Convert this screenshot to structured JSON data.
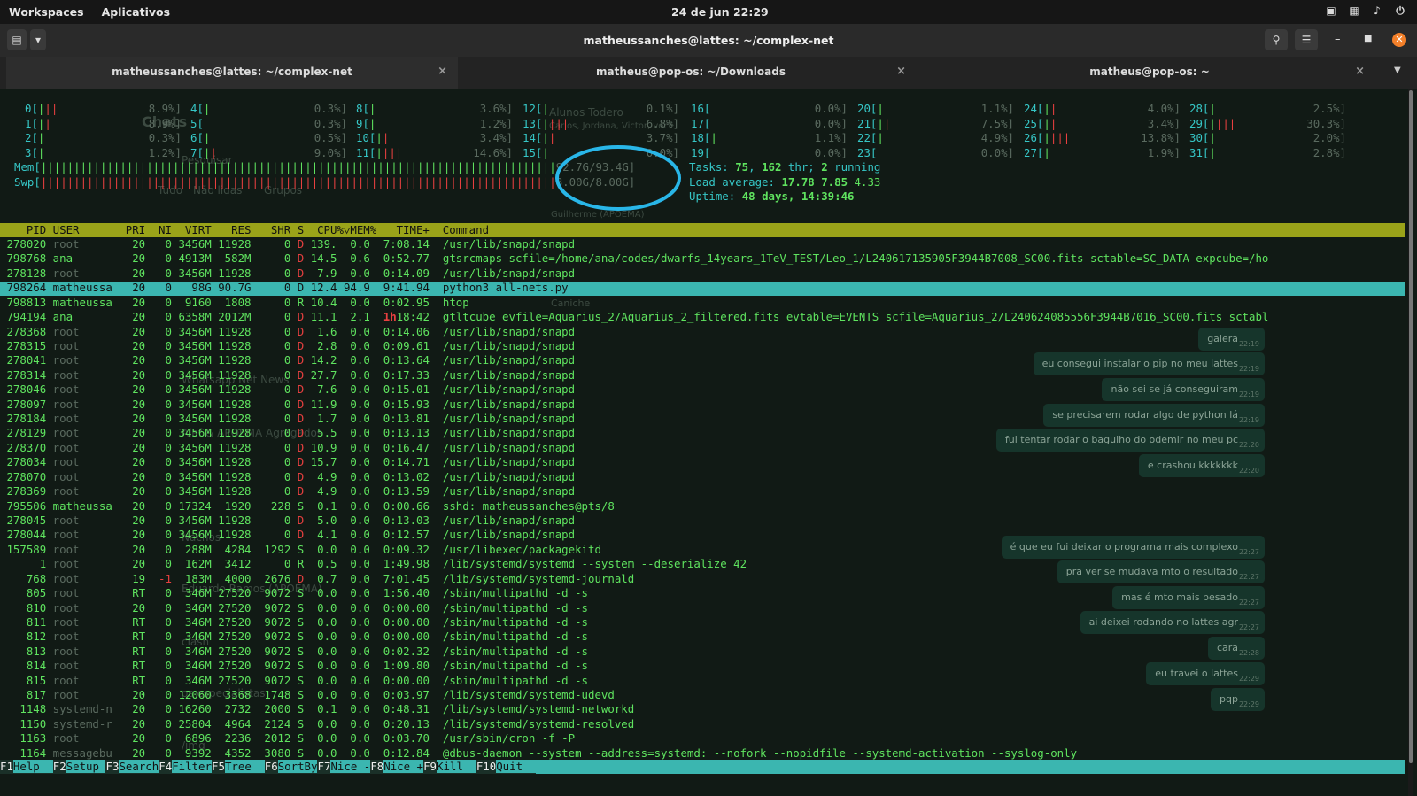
{
  "topbar": {
    "workspaces": "Workspaces",
    "apps": "Aplicativos",
    "clock": "24 de jun  22:29"
  },
  "window": {
    "title": "matheussanches@lattes: ~/complex-net"
  },
  "tabs": [
    {
      "label": "matheussanches@lattes: ~/complex-net",
      "active": true
    },
    {
      "label": "matheus@pop-os: ~/Downloads",
      "active": false
    },
    {
      "label": "matheus@pop-os: ~",
      "active": false
    }
  ],
  "htop": {
    "cpus": [
      [
        "0[|||",
        "8.9%]",
        "4[|",
        "0.3%]",
        "8[|",
        "3.6%]",
        "12[|",
        "0.1%]",
        "16[",
        "0.0%]",
        "20[|",
        "1.1%]",
        "24[||",
        "4.0%]",
        "28[|",
        "2.5%]"
      ],
      [
        "1[||",
        "8.9%]",
        "5[",
        "0.3%]",
        "9[|",
        "1.2%]",
        "13[||||",
        "6.8%]",
        "17[",
        "0.0%]",
        "21[||",
        "7.5%]",
        "25[||",
        "3.4%]",
        "29[||||",
        "30.3%]"
      ],
      [
        "2[|",
        "0.3%]",
        "6[|",
        "0.5%]",
        "10[||",
        "3.4%]",
        "14[||",
        "3.7%]",
        "18[|",
        "1.1%]",
        "22[|",
        "4.9%]",
        "26[||||",
        "13.8%]",
        "30[|",
        "2.0%]"
      ],
      [
        "3[|",
        "1.2%]",
        "7[||",
        "9.0%]",
        "11[||||",
        "14.6%]",
        "15[|",
        "0.0%]",
        "19[",
        "0.0%]",
        "23[",
        "0.0%]",
        "27[|",
        "1.9%]",
        "31[|",
        "2.8%]"
      ]
    ],
    "mem_label": "Mem[",
    "mem_value": "92.7G/93.4G]",
    "swp_label": "Swp[",
    "swp_value": "8.00G/8.00G]",
    "tasks_text": "Tasks: ",
    "tasks": "75",
    "thr": "162",
    "thr_label": " thr; ",
    "running": "2",
    "running_label": " running",
    "load_label": "Load average: ",
    "load1": "17.78",
    "load5": "7.85",
    "load15": "4.33",
    "uptime_label": "Uptime: ",
    "uptime": "48 days, 14:39:46",
    "header": "    PID USER       PRI  NI  VIRT   RES   SHR S  CPU%▽MEM%   TIME+  Command",
    "rows": [
      {
        "pid": "278020",
        "user": "root",
        "pri": "20",
        "ni": "0",
        "virt": "3456M",
        "res": "11928",
        "shr": "0",
        "s": "D",
        "cpu": "139.",
        "mem": "0.0",
        "time": "7:08.14",
        "cmd": "/usr/lib/snapd/snapd"
      },
      {
        "pid": "798768",
        "user": "ana",
        "pri": "20",
        "ni": "0",
        "virt": "4913M",
        "res": "582M",
        "shr": "0",
        "s": "D",
        "cpu": "14.5",
        "mem": "0.6",
        "time": "0:52.77",
        "cmd": "gtsrcmaps scfile=/home/ana/codes/dwarfs_14years_1TeV_TEST/Leo_1/L240617135905F3944B7008_SC00.fits sctable=SC_DATA expcube=/ho"
      },
      {
        "pid": "278128",
        "user": "root",
        "pri": "20",
        "ni": "0",
        "virt": "3456M",
        "res": "11928",
        "shr": "0",
        "s": "D",
        "cpu": "7.9",
        "mem": "0.0",
        "time": "0:14.09",
        "cmd": "/usr/lib/snapd/snapd"
      },
      {
        "pid": "798264",
        "user": "matheussa",
        "pri": "20",
        "ni": "0",
        "virt": "98G",
        "res": "90.7G",
        "shr": "0",
        "s": "D",
        "cpu": "12.4",
        "mem": "94.9",
        "time": "9:41.94",
        "cmd": "python3 all-nets.py",
        "selected": true
      },
      {
        "pid": "798813",
        "user": "matheussa",
        "pri": "20",
        "ni": "0",
        "virt": "9160",
        "res": "1808",
        "shr": "0",
        "s": "R",
        "cpu": "10.4",
        "mem": "0.0",
        "time": "0:02.95",
        "cmd": "htop"
      },
      {
        "pid": "794194",
        "user": "ana",
        "pri": "20",
        "ni": "0",
        "virt": "6358M",
        "res": "2012M",
        "shr": "0",
        "s": "D",
        "cpu": "11.1",
        "mem": "2.1",
        "time": "1h18:42",
        "cmd": "gtltcube evfile=Aquarius_2/Aquarius_2_filtered.fits evtable=EVENTS scfile=Aquarius_2/L240624085556F3944B7016_SC00.fits sctabl"
      },
      {
        "pid": "278368",
        "user": "root",
        "pri": "20",
        "ni": "0",
        "virt": "3456M",
        "res": "11928",
        "shr": "0",
        "s": "D",
        "cpu": "1.6",
        "mem": "0.0",
        "time": "0:14.06",
        "cmd": "/usr/lib/snapd/snapd"
      },
      {
        "pid": "278315",
        "user": "root",
        "pri": "20",
        "ni": "0",
        "virt": "3456M",
        "res": "11928",
        "shr": "0",
        "s": "D",
        "cpu": "2.8",
        "mem": "0.0",
        "time": "0:09.61",
        "cmd": "/usr/lib/snapd/snapd"
      },
      {
        "pid": "278041",
        "user": "root",
        "pri": "20",
        "ni": "0",
        "virt": "3456M",
        "res": "11928",
        "shr": "0",
        "s": "D",
        "cpu": "14.2",
        "mem": "0.0",
        "time": "0:13.64",
        "cmd": "/usr/lib/snapd/snapd"
      },
      {
        "pid": "278314",
        "user": "root",
        "pri": "20",
        "ni": "0",
        "virt": "3456M",
        "res": "11928",
        "shr": "0",
        "s": "D",
        "cpu": "27.7",
        "mem": "0.0",
        "time": "0:17.33",
        "cmd": "/usr/lib/snapd/snapd"
      },
      {
        "pid": "278046",
        "user": "root",
        "pri": "20",
        "ni": "0",
        "virt": "3456M",
        "res": "11928",
        "shr": "0",
        "s": "D",
        "cpu": "7.6",
        "mem": "0.0",
        "time": "0:15.01",
        "cmd": "/usr/lib/snapd/snapd"
      },
      {
        "pid": "278097",
        "user": "root",
        "pri": "20",
        "ni": "0",
        "virt": "3456M",
        "res": "11928",
        "shr": "0",
        "s": "D",
        "cpu": "11.9",
        "mem": "0.0",
        "time": "0:15.93",
        "cmd": "/usr/lib/snapd/snapd"
      },
      {
        "pid": "278184",
        "user": "root",
        "pri": "20",
        "ni": "0",
        "virt": "3456M",
        "res": "11928",
        "shr": "0",
        "s": "D",
        "cpu": "1.7",
        "mem": "0.0",
        "time": "0:13.81",
        "cmd": "/usr/lib/snapd/snapd"
      },
      {
        "pid": "278129",
        "user": "root",
        "pri": "20",
        "ni": "0",
        "virt": "3456M",
        "res": "11928",
        "shr": "0",
        "s": "D",
        "cpu": "5.5",
        "mem": "0.0",
        "time": "0:13.13",
        "cmd": "/usr/lib/snapd/snapd"
      },
      {
        "pid": "278370",
        "user": "root",
        "pri": "20",
        "ni": "0",
        "virt": "3456M",
        "res": "11928",
        "shr": "0",
        "s": "D",
        "cpu": "10.9",
        "mem": "0.0",
        "time": "0:16.47",
        "cmd": "/usr/lib/snapd/snapd"
      },
      {
        "pid": "278034",
        "user": "root",
        "pri": "20",
        "ni": "0",
        "virt": "3456M",
        "res": "11928",
        "shr": "0",
        "s": "D",
        "cpu": "15.7",
        "mem": "0.0",
        "time": "0:14.71",
        "cmd": "/usr/lib/snapd/snapd"
      },
      {
        "pid": "278070",
        "user": "root",
        "pri": "20",
        "ni": "0",
        "virt": "3456M",
        "res": "11928",
        "shr": "0",
        "s": "D",
        "cpu": "4.9",
        "mem": "0.0",
        "time": "0:13.02",
        "cmd": "/usr/lib/snapd/snapd"
      },
      {
        "pid": "278369",
        "user": "root",
        "pri": "20",
        "ni": "0",
        "virt": "3456M",
        "res": "11928",
        "shr": "0",
        "s": "D",
        "cpu": "4.9",
        "mem": "0.0",
        "time": "0:13.59",
        "cmd": "/usr/lib/snapd/snapd"
      },
      {
        "pid": "795506",
        "user": "matheussa",
        "pri": "20",
        "ni": "0",
        "virt": "17324",
        "res": "1920",
        "shr": "228",
        "s": "S",
        "cpu": "0.1",
        "mem": "0.0",
        "time": "0:00.66",
        "cmd": "sshd: matheussanches@pts/8"
      },
      {
        "pid": "278045",
        "user": "root",
        "pri": "20",
        "ni": "0",
        "virt": "3456M",
        "res": "11928",
        "shr": "0",
        "s": "D",
        "cpu": "5.0",
        "mem": "0.0",
        "time": "0:13.03",
        "cmd": "/usr/lib/snapd/snapd"
      },
      {
        "pid": "278044",
        "user": "root",
        "pri": "20",
        "ni": "0",
        "virt": "3456M",
        "res": "11928",
        "shr": "0",
        "s": "D",
        "cpu": "4.1",
        "mem": "0.0",
        "time": "0:12.57",
        "cmd": "/usr/lib/snapd/snapd"
      },
      {
        "pid": "157589",
        "user": "root",
        "pri": "20",
        "ni": "0",
        "virt": "288M",
        "res": "4284",
        "shr": "1292",
        "s": "S",
        "cpu": "0.0",
        "mem": "0.0",
        "time": "0:09.32",
        "cmd": "/usr/libexec/packagekitd"
      },
      {
        "pid": "1",
        "user": "root",
        "pri": "20",
        "ni": "0",
        "virt": "162M",
        "res": "3412",
        "shr": "0",
        "s": "R",
        "cpu": "0.5",
        "mem": "0.0",
        "time": "1:49.98",
        "cmd": "/lib/systemd/systemd --system --deserialize 42"
      },
      {
        "pid": "768",
        "user": "root",
        "pri": "19",
        "ni": "-1",
        "virt": "183M",
        "res": "4000",
        "shr": "2676",
        "s": "D",
        "cpu": "0.7",
        "mem": "0.0",
        "time": "7:01.45",
        "cmd": "/lib/systemd/systemd-journald"
      },
      {
        "pid": "805",
        "user": "root",
        "pri": "RT",
        "ni": "0",
        "virt": "346M",
        "res": "27520",
        "shr": "9072",
        "s": "S",
        "cpu": "0.0",
        "mem": "0.0",
        "time": "1:56.40",
        "cmd": "/sbin/multipathd -d -s"
      },
      {
        "pid": "810",
        "user": "root",
        "pri": "20",
        "ni": "0",
        "virt": "346M",
        "res": "27520",
        "shr": "9072",
        "s": "S",
        "cpu": "0.0",
        "mem": "0.0",
        "time": "0:00.00",
        "cmd": "/sbin/multipathd -d -s"
      },
      {
        "pid": "811",
        "user": "root",
        "pri": "RT",
        "ni": "0",
        "virt": "346M",
        "res": "27520",
        "shr": "9072",
        "s": "S",
        "cpu": "0.0",
        "mem": "0.0",
        "time": "0:00.00",
        "cmd": "/sbin/multipathd -d -s"
      },
      {
        "pid": "812",
        "user": "root",
        "pri": "RT",
        "ni": "0",
        "virt": "346M",
        "res": "27520",
        "shr": "9072",
        "s": "S",
        "cpu": "0.0",
        "mem": "0.0",
        "time": "0:00.00",
        "cmd": "/sbin/multipathd -d -s"
      },
      {
        "pid": "813",
        "user": "root",
        "pri": "RT",
        "ni": "0",
        "virt": "346M",
        "res": "27520",
        "shr": "9072",
        "s": "S",
        "cpu": "0.0",
        "mem": "0.0",
        "time": "0:02.32",
        "cmd": "/sbin/multipathd -d -s"
      },
      {
        "pid": "814",
        "user": "root",
        "pri": "RT",
        "ni": "0",
        "virt": "346M",
        "res": "27520",
        "shr": "9072",
        "s": "S",
        "cpu": "0.0",
        "mem": "0.0",
        "time": "1:09.80",
        "cmd": "/sbin/multipathd -d -s"
      },
      {
        "pid": "815",
        "user": "root",
        "pri": "RT",
        "ni": "0",
        "virt": "346M",
        "res": "27520",
        "shr": "9072",
        "s": "S",
        "cpu": "0.0",
        "mem": "0.0",
        "time": "0:00.00",
        "cmd": "/sbin/multipathd -d -s"
      },
      {
        "pid": "817",
        "user": "root",
        "pri": "20",
        "ni": "0",
        "virt": "12060",
        "res": "3368",
        "shr": "1748",
        "s": "S",
        "cpu": "0.0",
        "mem": "0.0",
        "time": "0:03.97",
        "cmd": "/lib/systemd/systemd-udevd"
      },
      {
        "pid": "1148",
        "user": "systemd-n",
        "pri": "20",
        "ni": "0",
        "virt": "16260",
        "res": "2732",
        "shr": "2000",
        "s": "S",
        "cpu": "0.1",
        "mem": "0.0",
        "time": "0:48.31",
        "cmd": "/lib/systemd/systemd-networkd"
      },
      {
        "pid": "1150",
        "user": "systemd-r",
        "pri": "20",
        "ni": "0",
        "virt": "25804",
        "res": "4964",
        "shr": "2124",
        "s": "S",
        "cpu": "0.0",
        "mem": "0.0",
        "time": "0:20.13",
        "cmd": "/lib/systemd/systemd-resolved"
      },
      {
        "pid": "1163",
        "user": "root",
        "pri": "20",
        "ni": "0",
        "virt": "6896",
        "res": "2236",
        "shr": "2012",
        "s": "S",
        "cpu": "0.0",
        "mem": "0.0",
        "time": "0:03.70",
        "cmd": "/usr/sbin/cron -f -P"
      },
      {
        "pid": "1164",
        "user": "messagebu",
        "pri": "20",
        "ni": "0",
        "virt": "9392",
        "res": "4352",
        "shr": "3080",
        "s": "S",
        "cpu": "0.0",
        "mem": "0.0",
        "time": "0:12.84",
        "cmd": "@dbus-daemon --system --address=systemd: --nofork --nopidfile --systemd-activation --syslog-only"
      }
    ],
    "fkeys": [
      {
        "k": "F1",
        "l": "Help  "
      },
      {
        "k": "F2",
        "l": "Setup "
      },
      {
        "k": "F3",
        "l": "Search"
      },
      {
        "k": "F4",
        "l": "Filter"
      },
      {
        "k": "F5",
        "l": "Tree  "
      },
      {
        "k": "F6",
        "l": "SortBy"
      },
      {
        "k": "F7",
        "l": "Nice -"
      },
      {
        "k": "F8",
        "l": "Nice +"
      },
      {
        "k": "F9",
        "l": "Kill  "
      },
      {
        "k": "F10",
        "l": "Quit  "
      }
    ]
  },
  "ghost_chat": {
    "title": "Chats",
    "search": "Pesquisar",
    "filters": [
      "Tudo",
      "Não lidas",
      "Grupos"
    ],
    "contact": "Alunos Todero",
    "members": "Carlos, Jordana, Victor, você",
    "list": [
      "Guilherme (APOEMA)",
      "Caniche",
      "Whatsapp Net News",
      "Alef & APOEMA Agregados",
      "Nachos",
      "Eduardo Ramos (APOEMA)",
      "clash",
      "os especialistas",
      "/img"
    ],
    "messages": [
      {
        "text": "galera",
        "time": "22:19"
      },
      {
        "text": "eu consegui instalar o pip no meu lattes",
        "time": "22:19"
      },
      {
        "text": "não sei se já conseguiram",
        "time": "22:19"
      },
      {
        "text": "se precisarem rodar algo de python lá",
        "time": "22:19"
      },
      {
        "text": "fui tentar rodar o bagulho do odemir no meu pc",
        "time": "22:20"
      },
      {
        "text": "e crashou kkkkkkk",
        "time": "22:20"
      },
      {
        "text": "é que eu fui deixar o programa mais complexo",
        "time": "22:27"
      },
      {
        "text": "pra ver se mudava mto o resultado",
        "time": "22:27"
      },
      {
        "text": "mas é mto mais pesado",
        "time": "22:27"
      },
      {
        "text": "ai deixei rodando no lattes agr",
        "time": "22:27"
      },
      {
        "text": "cara",
        "time": "22:28"
      },
      {
        "text": "eu travei o lattes",
        "time": "22:29"
      },
      {
        "text": "pqp",
        "time": "22:29"
      }
    ]
  },
  "colors": {
    "accent_tab": "#e8a14d",
    "header_row": "#9aa319",
    "selected_row": "#3bb6b0",
    "annotation": "#29b6e8"
  }
}
